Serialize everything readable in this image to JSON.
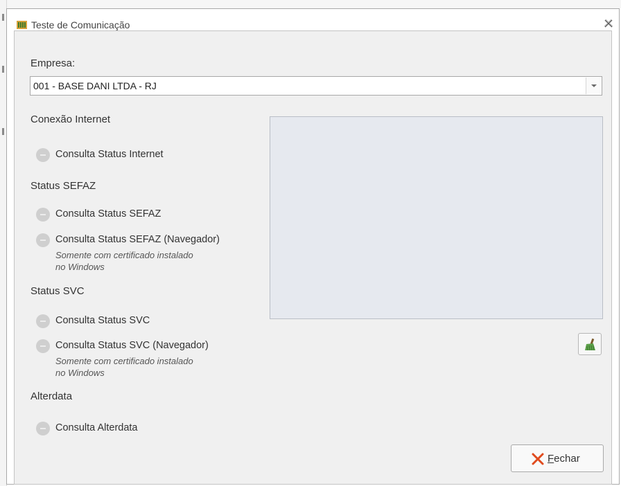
{
  "window": {
    "title": "Teste de Comunicação",
    "close_icon": "close-icon"
  },
  "empresa": {
    "label": "Empresa:",
    "selected": "001 - BASE DANI LTDA - RJ"
  },
  "sections": {
    "internet": {
      "title": "Conexão Internet",
      "items": [
        {
          "label": "Consulta Status Internet"
        }
      ]
    },
    "sefaz": {
      "title": "Status SEFAZ",
      "items": [
        {
          "label": "Consulta Status SEFAZ"
        },
        {
          "label": "Consulta Status SEFAZ (Navegador)",
          "note_line1": "Somente com certificado instalado",
          "note_line2": "no Windows"
        }
      ]
    },
    "svc": {
      "title": "Status SVC",
      "items": [
        {
          "label": "Consulta Status SVC"
        },
        {
          "label": "Consulta Status SVC (Navegador)",
          "note_line1": "Somente com certificado instalado",
          "note_line2": "no Windows"
        }
      ]
    },
    "alterdata": {
      "title": "Alterdata",
      "items": [
        {
          "label": "Consulta Alterdata"
        }
      ]
    }
  },
  "buttons": {
    "clear_icon": "broom-icon",
    "close_first": "F",
    "close_rest": "echar"
  },
  "colors": {
    "panel_bg": "#f0f0f0",
    "output_bg": "#e6e9ef",
    "status_dot": "#cfcfcf",
    "close_x": "#e04b1e",
    "broom_green": "#5ca04a"
  }
}
